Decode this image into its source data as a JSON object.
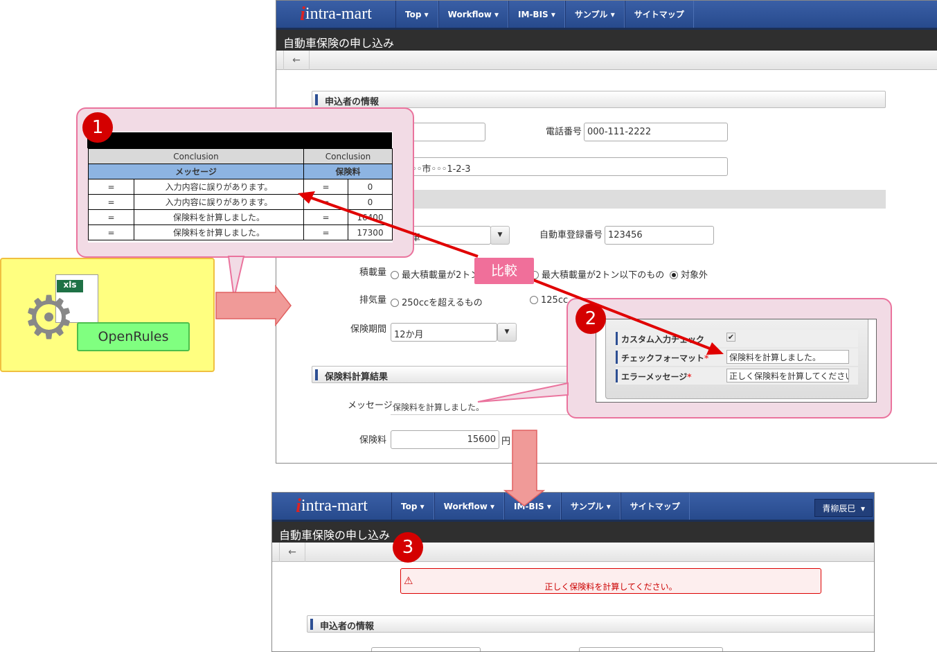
{
  "app": {
    "logo": "intra-mart",
    "nav": [
      "Top",
      "Workflow",
      "IM-BIS",
      "サンプル",
      "サイトマップ"
    ],
    "page_title": "自動車保険の申し込み",
    "back": "←",
    "user": "青柳辰巳"
  },
  "form": {
    "section_applicant": "申込者の情報",
    "phone_label": "電話番号",
    "phone_value": "000-111-2222",
    "address_value": "◦◦市◦◦◦1-2-3",
    "car_type_value": "車",
    "reg_label": "自動車登録番号",
    "reg_value": "123456",
    "load_label": "積載量",
    "load_options": [
      "最大積載量が2トン",
      "最大積載量が2トン以下のもの",
      "対象外"
    ],
    "engine_label": "排気量",
    "engine_options": [
      "250ccを超えるもの",
      "125cc"
    ],
    "period_label": "保険期間",
    "period_value": "12か月",
    "section_result": "保険料計算結果",
    "message_label": "メッセージ",
    "message_value": "保険料を計算しました。",
    "fee_label": "保険料",
    "fee_value": "15600",
    "fee_unit": "円"
  },
  "decision_table": {
    "header": [
      "Conclusion",
      "Conclusion"
    ],
    "subheader": [
      "メッセージ",
      "保険料"
    ],
    "rows": [
      [
        "=",
        "入力内容に誤りがあります。",
        "=",
        "0"
      ],
      [
        "=",
        "入力内容に誤りがあります。",
        "=",
        "0"
      ],
      [
        "=",
        "保険料を計算しました。",
        "=",
        "16400"
      ],
      [
        "=",
        "保険料を計算しました。",
        "=",
        "17300"
      ]
    ]
  },
  "openrules": {
    "file_badge": "xls",
    "label": "OpenRules"
  },
  "compare_label": "比較",
  "markers": [
    "1",
    "2",
    "3"
  ],
  "validator": {
    "rows": [
      {
        "label": "カスタム入力チェック",
        "value": "✔"
      },
      {
        "label": "チェックフォーマット",
        "required": "*",
        "value": "保険料を計算しました。"
      },
      {
        "label": "エラーメッセージ",
        "required": "*",
        "value": "正しく保険料を計算してください。"
      }
    ]
  },
  "error_alert": "正しく保険料を計算してください。",
  "colors": {
    "nav": "#2d4f93",
    "callout": "#f2dbe5",
    "callout_border": "#ea739d",
    "marker": "#d40000",
    "arrow": "#e00000"
  }
}
